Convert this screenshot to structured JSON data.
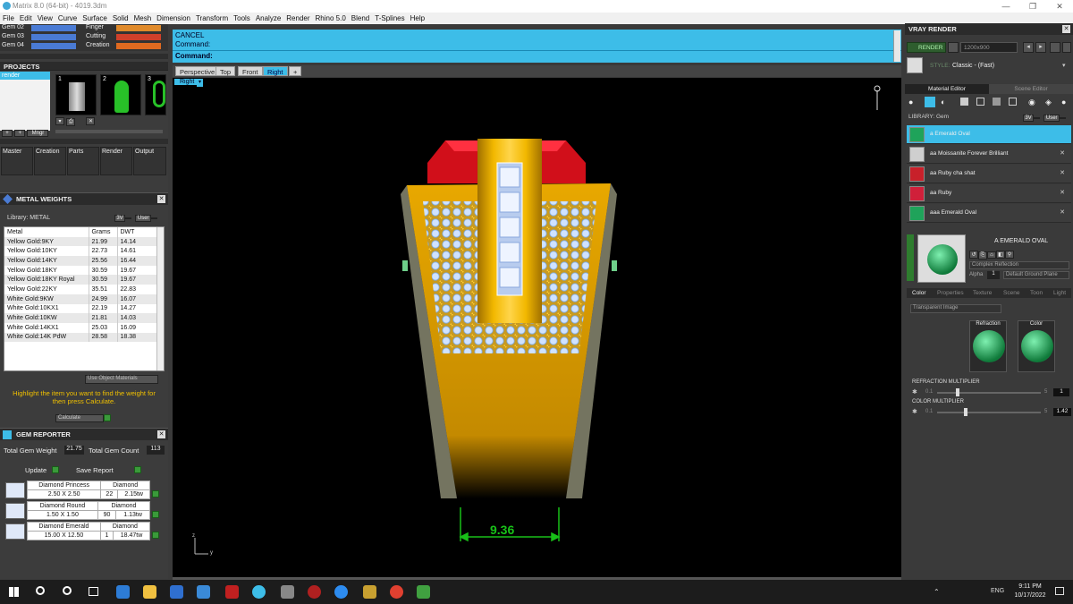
{
  "window": {
    "title": "Matrix 8.0 (64-bit) - 4019.3dm",
    "minimize": "—",
    "maximize": "❐",
    "close": "✕"
  },
  "menu": [
    "File",
    "Edit",
    "View",
    "Curve",
    "Surface",
    "Solid",
    "Mesh",
    "Dimension",
    "Transform",
    "Tools",
    "Analyze",
    "Render",
    "Rhino 5.0",
    "Blend",
    "T-Splines",
    "Help"
  ],
  "layers_left": [
    "Gem 02",
    "Gem 03",
    "Gem 04"
  ],
  "layers_right": [
    "Finger",
    "Cutting",
    "Creation"
  ],
  "projects": {
    "header": "PROJECTS",
    "item": "render",
    "thumbs": [
      "1",
      "2",
      "3"
    ],
    "mngr": "Mngr"
  },
  "tabs_row": [
    "Master",
    "Creation",
    "Parts",
    "Render",
    "Output"
  ],
  "metal_weights": {
    "header": "METAL WEIGHTS",
    "library_label": "Library: METAL",
    "toggle": [
      "3V",
      "User"
    ],
    "columns": [
      "Metal",
      "Grams",
      "DWT"
    ],
    "rows": [
      [
        "Yellow Gold:9KY",
        "21.99",
        "14.14"
      ],
      [
        "Yellow Gold:10KY",
        "22.73",
        "14.61"
      ],
      [
        "Yellow Gold:14KY",
        "25.56",
        "16.44"
      ],
      [
        "Yellow Gold:18KY",
        "30.59",
        "19.67"
      ],
      [
        "Yellow Gold:18KY Royal",
        "30.59",
        "19.67"
      ],
      [
        "Yellow Gold:22KY",
        "35.51",
        "22.83"
      ],
      [
        "White Gold:9KW",
        "24.99",
        "16.07"
      ],
      [
        "White Gold:10KX1",
        "22.19",
        "14.27"
      ],
      [
        "White Gold:10KW",
        "21.81",
        "14.03"
      ],
      [
        "White Gold:14KX1",
        "25.03",
        "16.09"
      ],
      [
        "White Gold:14K PdW",
        "28.58",
        "18.38"
      ]
    ],
    "use_object": "Use Object Materials",
    "hint": "Highlight the item you want to find the weight for then press Calculate.",
    "calculate": "Calculate"
  },
  "gem_reporter": {
    "header": "GEM REPORTER",
    "total_weight_label": "Total Gem Weight",
    "total_weight": "21.75",
    "total_count_label": "Total Gem Count",
    "total_count": "113",
    "update": "Update",
    "save_report": "Save Report",
    "gems": [
      {
        "name": "Diamond Princess",
        "size": "2.50 X 2.50",
        "material": "Diamond",
        "count": "22",
        "weight": "2.15tw"
      },
      {
        "name": "Diamond Round",
        "size": "1.50 X 1.50",
        "material": "Diamond",
        "count": "90",
        "weight": "1.13tw"
      },
      {
        "name": "Diamond Emerald",
        "size": "15.00 X 12.50",
        "material": "Diamond",
        "count": "1",
        "weight": "18.47tw"
      }
    ]
  },
  "command": {
    "line1": "CANCEL",
    "line2": "Command:",
    "prompt": "Command:"
  },
  "view_tabs": [
    "Perspective",
    "Top",
    "Front",
    "Right",
    "+"
  ],
  "active_view": "Right",
  "viewport_label": "Right",
  "dimension": "9.36",
  "axis": {
    "z": "z",
    "y": "y"
  },
  "vray": {
    "header": "VRAY RENDER",
    "render_btn": "RENDER",
    "resolution": "1200x900",
    "style_label": "STYLE:",
    "style_value": "Classic - (Fast)",
    "tabs": [
      "Material Editor",
      "Scene Editor"
    ],
    "library_label": "LIBRARY: Gem",
    "toggle": [
      "3V",
      "User"
    ],
    "materials": [
      {
        "name": "a Emerald Oval",
        "color": "#1fa35a"
      },
      {
        "name": "aa Moissanite Forever Brilliant",
        "color": "#cfcfcf"
      },
      {
        "name": "aa Ruby cha shat",
        "color": "#c8202a"
      },
      {
        "name": "aa Ruby",
        "color": "#d0203a"
      },
      {
        "name": "aaa Emerald Oval",
        "color": "#1fa35a"
      }
    ],
    "selected_material": "A EMERALD OVAL",
    "complex_reflection": "Complex Reflection",
    "alpha": "Alpha",
    "alpha_val": "1",
    "ground": "Default Ground Plane",
    "prop_tabs": [
      "Color",
      "Properties",
      "Texture",
      "Scene",
      "Toon",
      "Light"
    ],
    "transparent": "Transparent Image",
    "refraction": "Refraction",
    "color": "Color",
    "refraction_multiplier": {
      "label": "REFRACTION MULTIPLIER",
      "min": "0.1",
      "max": "5",
      "value": "1",
      "fill": 0.18
    },
    "color_multiplier": {
      "label": "COLOR MULTIPLIER",
      "min": "0.1",
      "max": "5",
      "value": "1.42",
      "fill": 0.26
    }
  },
  "taskbar": {
    "time": "9:11 PM",
    "date": "10/17/2022",
    "lang": "ENG"
  }
}
